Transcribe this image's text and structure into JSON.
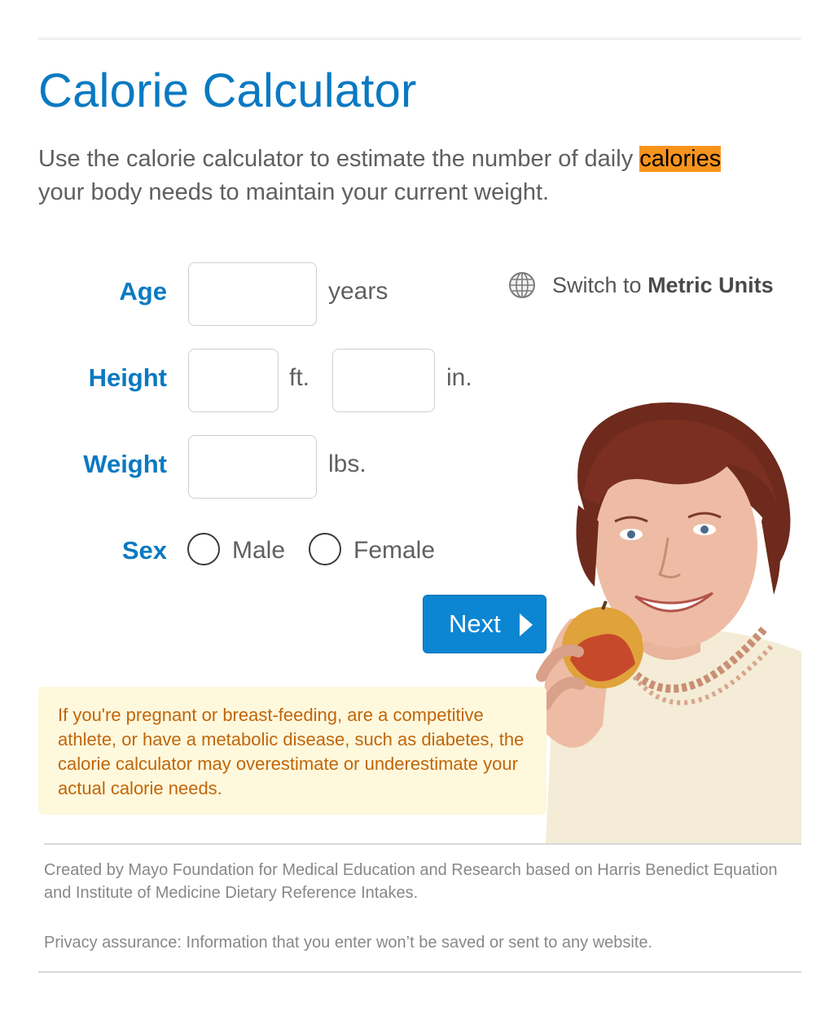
{
  "header": {
    "title": "Calorie Calculator"
  },
  "intro": {
    "before": "Use the calorie calculator to estimate the number of daily ",
    "highlight": "calories",
    "after": " your body needs to maintain your current weight."
  },
  "form": {
    "age": {
      "label": "Age",
      "value": "",
      "unit": "years"
    },
    "height": {
      "label": "Height",
      "feet_value": "",
      "feet_unit": "ft.",
      "inches_value": "",
      "inches_unit": "in."
    },
    "weight": {
      "label": "Weight",
      "value": "",
      "unit": "lbs."
    },
    "sex": {
      "label": "Sex",
      "options": [
        "Male",
        "Female"
      ]
    },
    "next_label": "Next"
  },
  "units_switch": {
    "prefix": "Switch to ",
    "bold": "Metric Units",
    "icon": "globe-icon"
  },
  "warning": "If you're pregnant or breast-feeding, are a competitive athlete, or have a metabolic disease, such as diabetes, the calorie calculator may overestimate or underestimate your actual calorie needs.",
  "footer": {
    "credit": "Created by Mayo Foundation for Medical Education and Research based on Harris Benedict Equation and Institute of Medicine Dietary Reference Intakes.",
    "privacy": "Privacy assurance: Information that you enter won’t be saved or sent to any website."
  },
  "colors": {
    "accent": "#0a79c2",
    "button": "#0c86d3",
    "highlight": "#f7941d",
    "warning_bg": "#fef8dd",
    "warning_text": "#c0660a"
  }
}
